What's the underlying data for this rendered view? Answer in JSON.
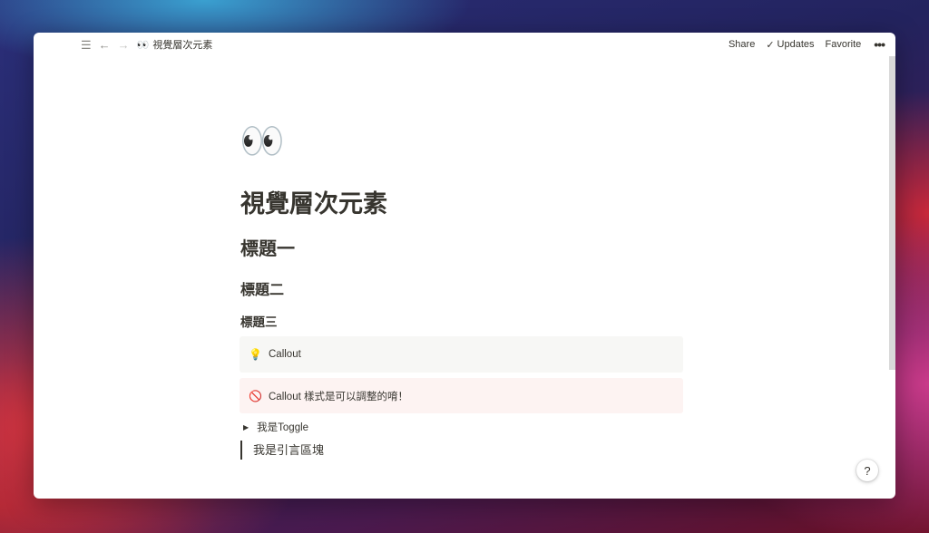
{
  "topbar": {
    "breadcrumb_emoji": "👀",
    "breadcrumb_title": "視覺層次元素",
    "share_label": "Share",
    "updates_label": "Updates",
    "favorite_label": "Favorite",
    "menu_icon": "hamburger-icon",
    "back_icon": "arrow-left-icon",
    "forward_icon": "arrow-right-icon",
    "more_icon": "more-dots-icon"
  },
  "page": {
    "icon_emoji": "👀",
    "title": "視覺層次元素",
    "heading1": "標題一",
    "heading2": "標題二",
    "heading3": "標題三",
    "callout1": {
      "icon": "💡",
      "text": "Callout"
    },
    "callout2": {
      "icon": "🚫",
      "text": "Callout 樣式是可以調整的唷！"
    },
    "toggle_text": "我是Toggle",
    "quote_text": "我是引言區塊"
  },
  "help_label": "?",
  "colors": {
    "text": "#37352f",
    "callout_gray": "#f7f7f5",
    "callout_red": "#fdf3f2"
  }
}
